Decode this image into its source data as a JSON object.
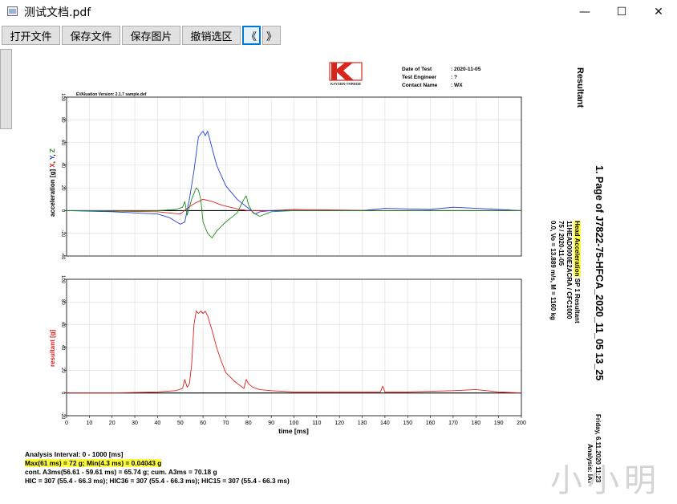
{
  "window": {
    "title": "测试文档.pdf",
    "minimize_glyph": "—",
    "maximize_glyph": "☐",
    "close_glyph": "✕"
  },
  "toolbar": {
    "open_label": "打开文件",
    "save_file_label": "保存文件",
    "save_image_label": "保存图片",
    "undo_label": "撤销选区",
    "prev_label": "《",
    "next_label": "》"
  },
  "header": {
    "logo_text": "KAYSER-THREDE",
    "date_label": "Date of Test",
    "date_value": ": 2020-11-05",
    "engineer_label": "Test Engineer",
    "engineer_value": ": ?",
    "contact_label": "Contact Name",
    "contact_value": ": WX",
    "eval_version": "EVAluation Version: 2.1.7 sample.def",
    "resultant_title": "Resultant"
  },
  "side": {
    "page_title": "1. Page of J7822-75-HFCA_2020_11_05 13_25",
    "channel_prefix": "Head Acceleration",
    "channel_suffix": " SP 1 Resultant",
    "channel_code": "11HEAD0000E2ACRA / CFC1000",
    "test_date": "75 / 2020-11-05",
    "velocity": "0.0, Vo = 13.889 m/s, M = 1160 kg",
    "footer_date": "Friday, 6.11.2020 11:23",
    "footer_org": "Analysis: IAT"
  },
  "summary": {
    "interval": "Analysis Interval:  0 - 1000 [ms]",
    "maxmin": "Max(61 ms) = 72 g;  Min(4.3 ms) = 0.04043 g",
    "a3ms": "cont. A3ms(56.61 - 59.61 ms) = 65.74 g; cum. A3ms = 70.18 g",
    "hic": "HIC = 307 (55.4 - 66.3 ms); HIC36 = 307 (55.4 - 66.3 ms); HIC15 = 307 (55.4 - 66.3 ms)"
  },
  "watermark": "小小明",
  "chart_data": [
    {
      "type": "line",
      "ylabel": "acceleration [g]",
      "ylabel_channels": [
        "X",
        "Y",
        "Z"
      ],
      "xlim": [
        0,
        200
      ],
      "ylim": [
        -40,
        100
      ],
      "yticks": [
        -40,
        -20,
        0,
        20,
        40,
        60,
        80,
        100
      ],
      "grid": true,
      "colors": {
        "X": "#e02020",
        "Y": "#1f3fd8",
        "Z": "#208a20"
      },
      "series": [
        {
          "name": "X",
          "color": "#e02020",
          "x": [
            0,
            40,
            45,
            50,
            53,
            56,
            60,
            64,
            68,
            72,
            76,
            80,
            90,
            100,
            140,
            180,
            200
          ],
          "y": [
            0,
            -1,
            -2,
            -3,
            2,
            6,
            10,
            8,
            5,
            3,
            1,
            0,
            0,
            1,
            0,
            0,
            0
          ]
        },
        {
          "name": "Y",
          "color": "#1f3fd8",
          "x": [
            0,
            20,
            30,
            40,
            45,
            50,
            52,
            54,
            56,
            58,
            60,
            61,
            62,
            64,
            66,
            70,
            75,
            80,
            83,
            85,
            90,
            100,
            130,
            140,
            160,
            170,
            180,
            190,
            200
          ],
          "y": [
            0,
            -1,
            -2,
            -3,
            -6,
            -12,
            -10,
            10,
            35,
            65,
            70,
            66,
            70,
            55,
            40,
            22,
            10,
            2,
            -3,
            -1,
            0,
            0,
            0,
            2,
            1,
            3,
            2,
            1,
            0
          ]
        },
        {
          "name": "Z",
          "color": "#208a20",
          "x": [
            0,
            40,
            48,
            51,
            52,
            53,
            55,
            57,
            58,
            59,
            60,
            62,
            64,
            66,
            70,
            75,
            78,
            79,
            80,
            82,
            85,
            90,
            100,
            140,
            200
          ],
          "y": [
            0,
            0,
            1,
            3,
            8,
            -4,
            10,
            20,
            18,
            10,
            -10,
            -20,
            -24,
            -18,
            -10,
            -2,
            10,
            13,
            5,
            -2,
            -5,
            -1,
            0,
            0,
            0
          ]
        }
      ]
    },
    {
      "type": "line",
      "ylabel": "resultant [g]",
      "xlabel": "time [ms]",
      "xlim": [
        0,
        200
      ],
      "ylim": [
        -20,
        100
      ],
      "xticks": [
        0,
        10,
        20,
        30,
        40,
        50,
        60,
        70,
        80,
        90,
        100,
        110,
        120,
        130,
        140,
        150,
        160,
        170,
        180,
        190,
        200
      ],
      "yticks": [
        -20,
        0,
        20,
        40,
        60,
        80,
        100
      ],
      "grid": true,
      "series": [
        {
          "name": "resultant",
          "color": "#e02020",
          "x": [
            0,
            20,
            40,
            48,
            51,
            52,
            53,
            54,
            55,
            56,
            57,
            58,
            59,
            60,
            61,
            62,
            64,
            66,
            68,
            70,
            74,
            78,
            79,
            80,
            82,
            85,
            90,
            100,
            120,
            138,
            139,
            140,
            150,
            170,
            180,
            190,
            200
          ],
          "y": [
            0,
            0,
            1,
            2,
            4,
            12,
            5,
            8,
            25,
            60,
            72,
            70,
            72,
            70,
            72,
            68,
            55,
            40,
            28,
            18,
            10,
            4,
            12,
            8,
            5,
            3,
            2,
            1,
            1,
            1,
            6,
            1,
            1,
            2,
            3,
            1,
            0
          ]
        }
      ]
    }
  ]
}
